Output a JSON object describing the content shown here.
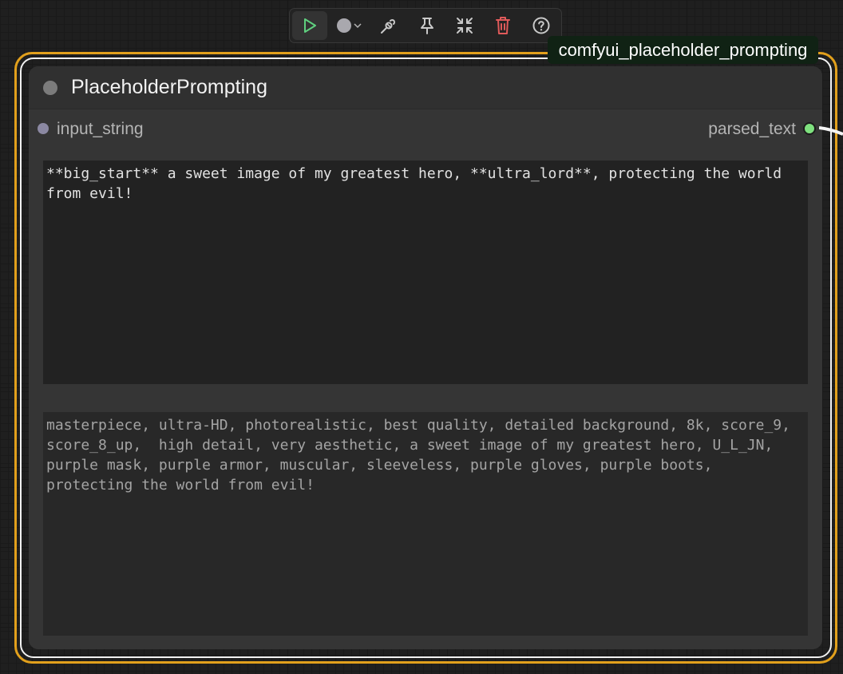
{
  "toolbar": {
    "buttons": [
      {
        "name": "run",
        "icon": "play-icon"
      },
      {
        "name": "color",
        "icon": "color-dot-icon",
        "color": "#a9a8ae"
      },
      {
        "name": "bypass",
        "icon": "bypass-icon"
      },
      {
        "name": "pin",
        "icon": "pin-icon"
      },
      {
        "name": "collapse",
        "icon": "collapse-icon"
      },
      {
        "name": "delete",
        "icon": "trash-icon"
      },
      {
        "name": "help",
        "icon": "help-icon"
      }
    ]
  },
  "node": {
    "badge": "comfyui_placeholder_prompting",
    "title": "PlaceholderPrompting",
    "input_slot": "input_string",
    "output_slot": "parsed_text",
    "input_text": "**big_start** a sweet image of my greatest hero, **ultra_lord**, protecting the world from evil!",
    "output_text": "masterpiece, ultra-HD, photorealistic, best quality, detailed background, 8k, score_9, score_8_up,  high detail, very aesthetic, a sweet image of my greatest hero, U_L_JN, purple mask, purple armor, muscular, sleeveless, purple gloves, purple boots, protecting the world from evil!"
  },
  "colors": {
    "selection": "#e2a01c",
    "output_slot": "#7ee07e",
    "input_slot": "#8b88a2",
    "run_icon": "#5fd07f",
    "delete_icon": "#e05a5a"
  }
}
